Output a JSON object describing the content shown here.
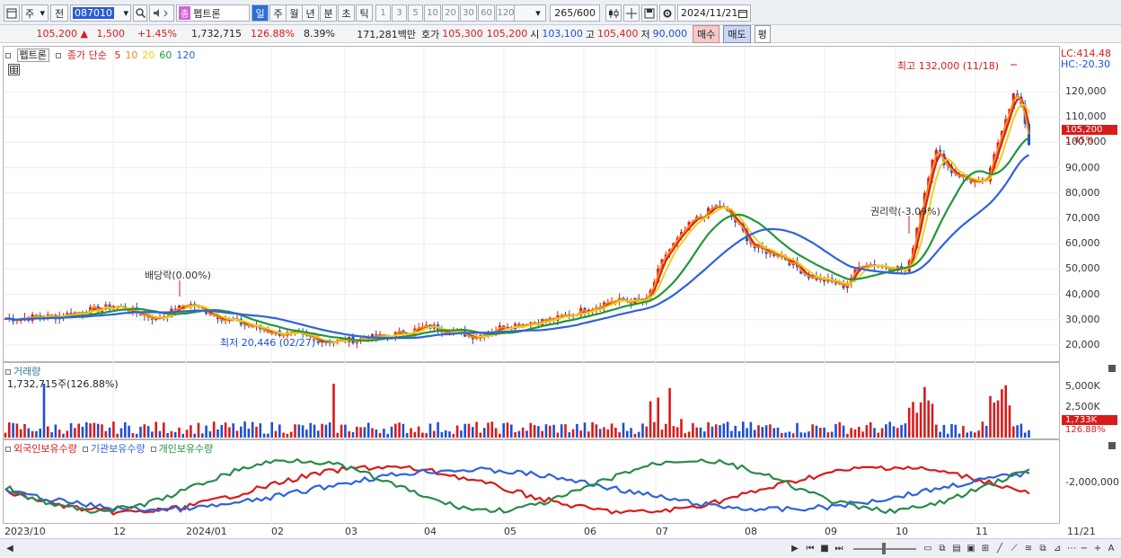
{
  "toolbar": {
    "period_select": "주",
    "prev_label": "전",
    "stock_code": "087010",
    "stock_name": "펩트론",
    "stock_badge": "종",
    "interval_tabs": [
      "일",
      "주",
      "월",
      "년",
      "분",
      "초",
      "틱"
    ],
    "interval_active": "일",
    "minute_options": [
      "1",
      "3",
      "5",
      "10",
      "20",
      "30",
      "60",
      "120"
    ],
    "count_value": "265",
    "count_total": "/600",
    "date_value": "2024/11/21"
  },
  "info": {
    "price": "105,200",
    "direction": "▲",
    "change": "1,500",
    "change_pct": "+1.45%",
    "volume": "1,732,715",
    "volume_ratio": "126.88%",
    "turnover": "8.39%",
    "amount": "171,281백만",
    "quote_label": "호가",
    "ask": "105,300",
    "bid": "105,200",
    "open_label": "시",
    "open": "103,100",
    "high_label": "고",
    "high": "105,400",
    "low_label": "저",
    "low": "90,000",
    "buy_label": "매수",
    "sell_label": "매도",
    "eval_label": "평"
  },
  "price_pane": {
    "legend_name": "펩트론",
    "legend_ma_title": "종가 단순",
    "legend_ma": [
      {
        "period": "5",
        "color": "#e01b1b"
      },
      {
        "period": "10",
        "color": "#f28c1a"
      },
      {
        "period": "20",
        "color": "#e8d21c"
      },
      {
        "period": "60",
        "color": "#21973a"
      },
      {
        "period": "120",
        "color": "#2f63d9"
      }
    ],
    "lc": "LC:414.48",
    "hc": "HC:-20.30",
    "y_ticks": [
      "120,000",
      "110,000",
      "100,000",
      "90,000",
      "80,000",
      "70,000",
      "60,000",
      "50,000",
      "40,000",
      "30,000",
      "20,000"
    ],
    "current_tag": "105,200",
    "current_pct": "1.45%",
    "annotations": {
      "high": "최고 132,000 (11/18)",
      "low": "최저 20,446 (02/27)",
      "dividend": "배당락(0.00%)",
      "rights": "권리락(-3.09%)"
    }
  },
  "volume_pane": {
    "title": "거래량",
    "value": "1,732,715주(126.88%)",
    "y_ticks": [
      "5,000K",
      "2,500K"
    ],
    "current_tag": "1,733K",
    "current_pct": "126.88%"
  },
  "holder_pane": {
    "legend": [
      {
        "label": "외국인보유수량",
        "color": "#d81b1b"
      },
      {
        "label": "기관보유수량",
        "color": "#2f63d9"
      },
      {
        "label": "개인보유수량",
        "color": "#2a8a4a"
      }
    ],
    "y_ticks": [
      "-2,000,000"
    ]
  },
  "x_axis": [
    "2023/10",
    "12",
    "2024/01",
    "02",
    "03",
    "04",
    "05",
    "06",
    "07",
    "08",
    "09",
    "10",
    "11",
    "11/21"
  ],
  "colors": {
    "up": "#d81b1b",
    "down": "#1f4fd1",
    "accent": "#e01b1b"
  }
}
